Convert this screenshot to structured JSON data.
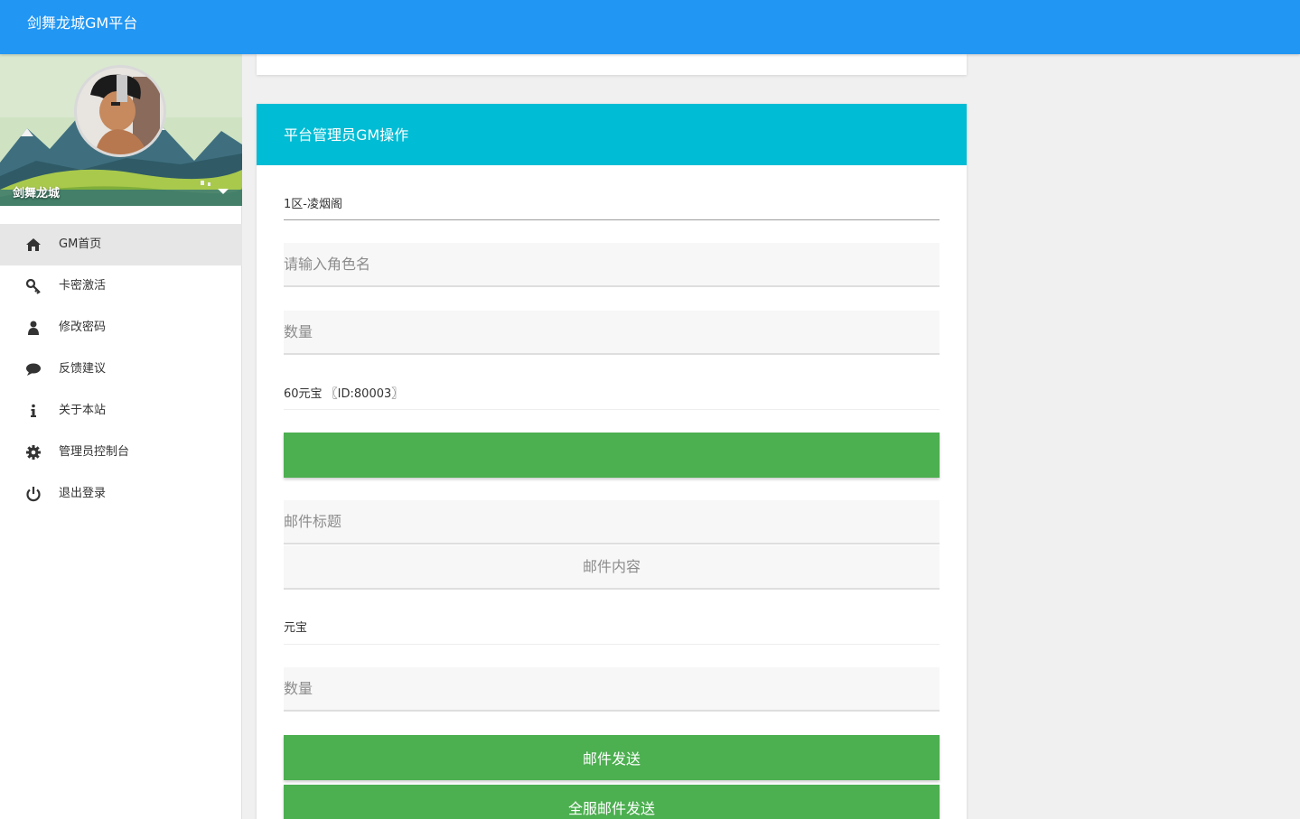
{
  "header": {
    "title": "剑舞龙城GM平台",
    "color": "#2196f3"
  },
  "profile": {
    "name": "剑舞龙城",
    "avatar_icon": "anime-avatar",
    "dropdown_icon": "caret-down-icon"
  },
  "sidebar": {
    "items": [
      {
        "label": "GM首页",
        "icon": "home-icon",
        "active": true
      },
      {
        "label": "卡密激活",
        "icon": "key-icon"
      },
      {
        "label": "修改密码",
        "icon": "user-icon"
      },
      {
        "label": "反馈建议",
        "icon": "comment-icon"
      },
      {
        "label": "关于本站",
        "icon": "info-icon"
      },
      {
        "label": "管理员控制台",
        "icon": "gear-icon"
      },
      {
        "label": "退出登录",
        "icon": "power-icon"
      }
    ]
  },
  "panel": {
    "title": "平台管理员GM操作",
    "header_color": "#00bcd4",
    "server_select": "1区-凌烟阁",
    "role_name_placeholder": "请输入角色名",
    "quantity_placeholder": "数量",
    "item_select": "60元宝 〖ID:80003〗",
    "mail_title_placeholder": "邮件标题",
    "mail_content_placeholder": "邮件内容",
    "attachment_select": "元宝",
    "attachment_quantity_placeholder": "数量",
    "send_mail_label": "邮件发送",
    "send_all_label": "全服邮件发送",
    "button_color": "#4caf50"
  }
}
